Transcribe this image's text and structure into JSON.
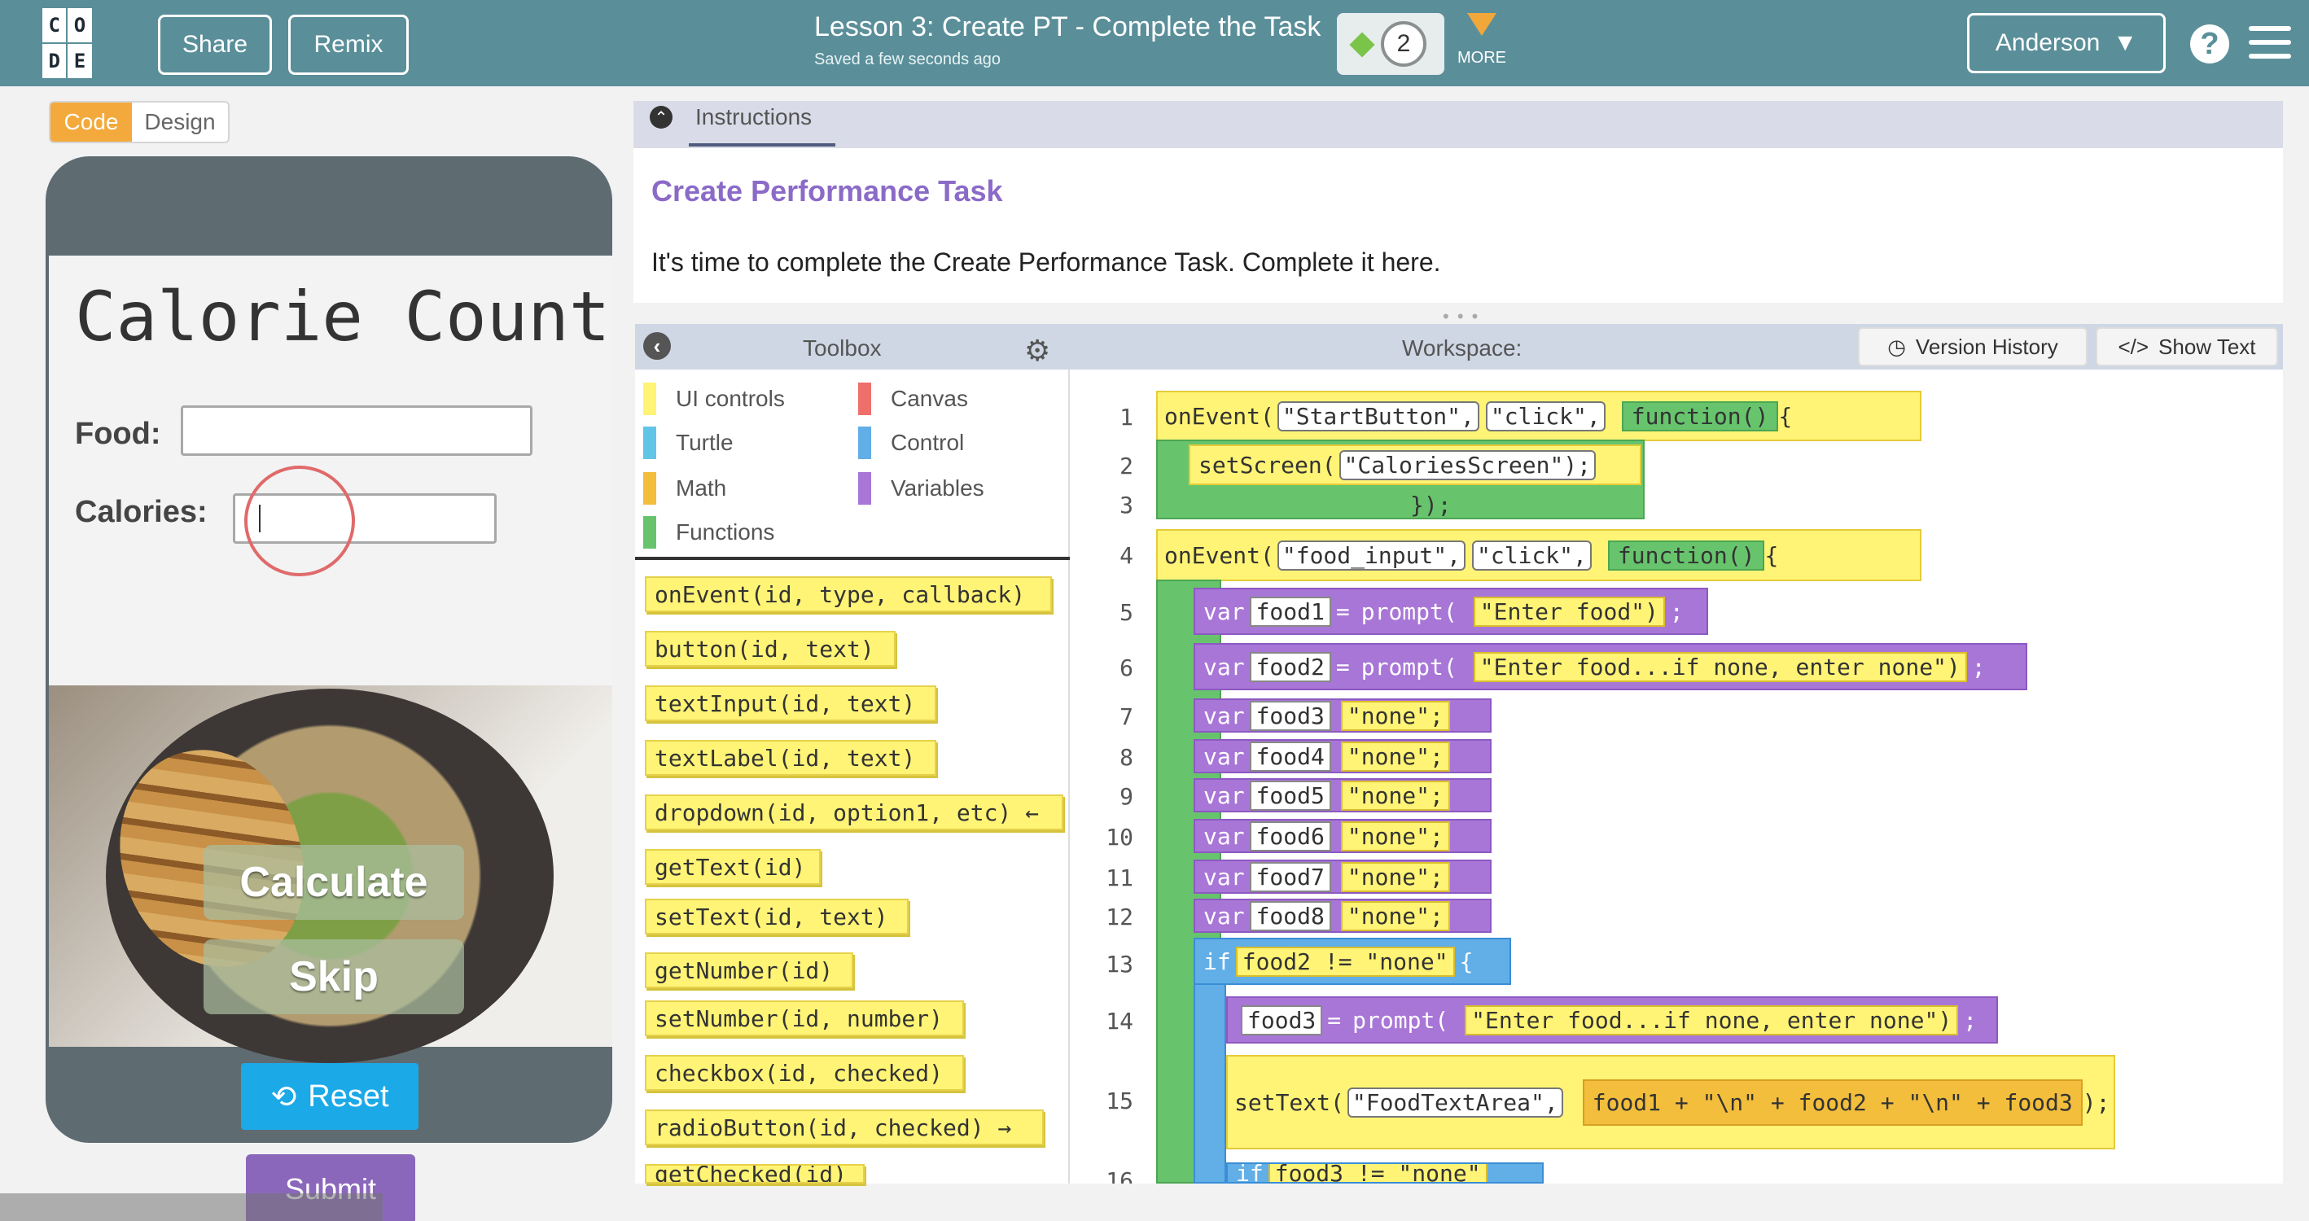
{
  "header": {
    "logo_letters": [
      "C",
      "O",
      "D",
      "E"
    ],
    "share_label": "Share",
    "remix_label": "Remix",
    "lesson_title": "Lesson 3: Create PT - Complete the Task",
    "saved_text": "Saved a few seconds ago",
    "progress_number": "2",
    "more_label": "MORE",
    "user_name": "Anderson"
  },
  "left_panel": {
    "code_tab": "Code",
    "design_tab": "Design",
    "app_title": "Calorie Count",
    "food_label": "Food:",
    "calories_label": "Calories:",
    "calculate_label": "Calculate",
    "skip_label": "Skip",
    "reset_label": "Reset",
    "submit_label": "Submit"
  },
  "instructions": {
    "tab_label": "Instructions",
    "title": "Create Performance Task",
    "text": "It's time to complete the Create Performance Task. Complete it here."
  },
  "toolbox": {
    "title": "Toolbox",
    "categories": [
      {
        "label": "UI controls",
        "color": "#fff476"
      },
      {
        "label": "Canvas",
        "color": "#ef6f6b"
      },
      {
        "label": "Turtle",
        "color": "#62c5e8"
      },
      {
        "label": "Control",
        "color": "#62aee7"
      },
      {
        "label": "Math",
        "color": "#f2be3c"
      },
      {
        "label": "Variables",
        "color": "#a876d6"
      },
      {
        "label": "Functions",
        "color": "#67c46d"
      }
    ],
    "blocks": [
      "onEvent(id, type, callback)",
      "button(id, text)",
      "textInput(id, text)",
      "textLabel(id, text)",
      "dropdown(id, option1, etc) ←",
      "getText(id)",
      "setText(id, text)",
      "getNumber(id)",
      "setNumber(id, number)",
      "checkbox(id, checked)",
      "radioButton(id, checked) →",
      "getChecked(id)"
    ]
  },
  "workspace": {
    "title": "Workspace:",
    "version_history_label": "Version History",
    "show_text_label": "Show Text",
    "line_numbers": [
      "1",
      "2",
      "3",
      "4",
      "5",
      "6",
      "7",
      "8",
      "9",
      "10",
      "11",
      "12",
      "13",
      "14",
      "15",
      "16"
    ],
    "code_lines": {
      "l1_onEvent": "onEvent(",
      "l1_id": "\"StartButton\",",
      "l1_event": "\"click\",",
      "l1_function": "function()",
      "l1_brace": "{",
      "l2_setScreen": "setScreen(",
      "l2_screen": "\"CaloriesScreen\");",
      "l3_close": "});",
      "l4_onEvent": "onEvent(",
      "l4_id": "\"food_input\",",
      "l4_event": "\"click\",",
      "l4_function": "function()",
      "l4_brace": "{",
      "l5_var": "var",
      "l5_name": "food1",
      "l5_eq": "=",
      "l5_prompt": "prompt(",
      "l5_value": "\"Enter food\")",
      "l5_semicolon": ";",
      "l6_var": "var",
      "l6_name": "food2",
      "l6_eq": "=",
      "l6_prompt": "prompt(",
      "l6_value": "\"Enter food...if none, enter none\")",
      "l6_semicolon": ";",
      "l7_var": "var",
      "l7_name": "food3",
      "l7_value": "\"none\";",
      "l8_var": "var",
      "l8_name": "food4",
      "l8_value": "\"none\";",
      "l9_var": "var",
      "l9_name": "food5",
      "l9_value": "\"none\";",
      "l10_var": "var",
      "l10_name": "food6",
      "l10_value": "\"none\";",
      "l11_var": "var",
      "l11_name": "food7",
      "l11_value": "\"none\";",
      "l12_var": "var",
      "l12_name": "food8",
      "l12_value": "\"none\";",
      "l13_if": "if",
      "l13_cond": "food2 != \"none\"",
      "l13_brace": "{",
      "l14_name": "food3",
      "l14_eq": "=",
      "l14_prompt": "prompt(",
      "l14_value": "\"Enter food...if none, enter none\")",
      "l14_semicolon": ";",
      "l15_setText": "setText(",
      "l15_area": "\"FoodTextArea\",",
      "l15_expr": "food1 + \"\\n\" + food2 + \"\\n\" + food3",
      "l15_semicolon": ");",
      "l16_if": "if",
      "l16_cond": "food3 != \"none\""
    }
  }
}
